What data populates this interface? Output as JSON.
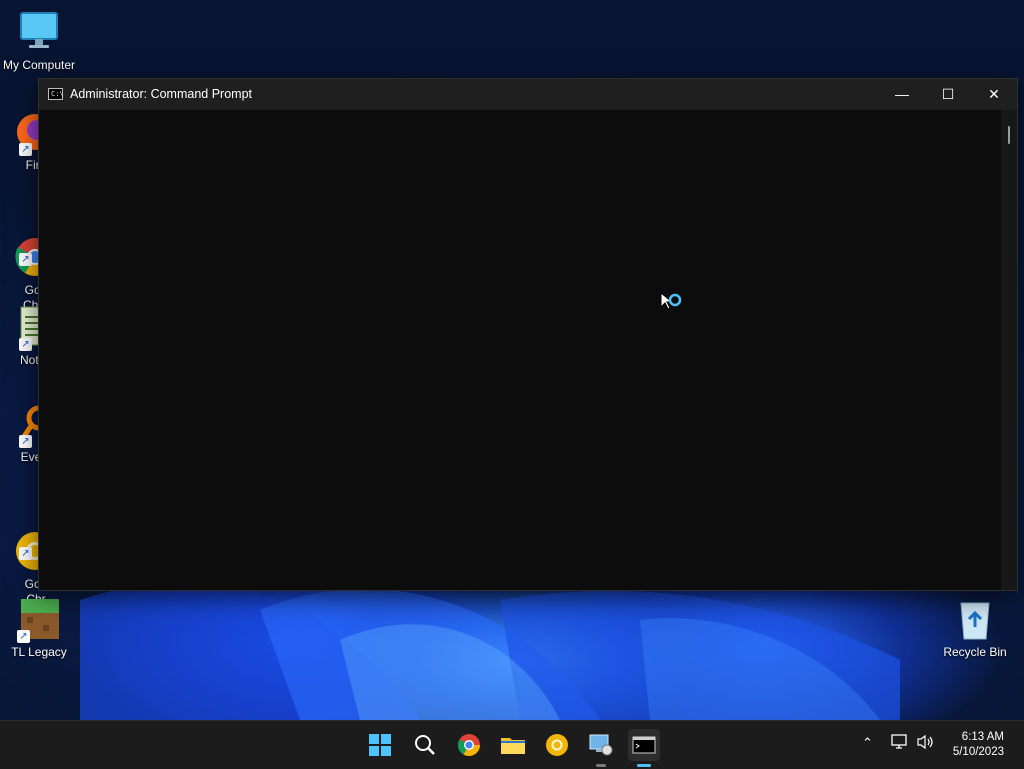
{
  "desktop": {
    "icons": [
      {
        "label": "My Computer"
      },
      {
        "label": "Fire"
      },
      {
        "label": "Goo\nChro"
      },
      {
        "label": "Notep"
      },
      {
        "label": "Every"
      },
      {
        "label": "Goo\nChr"
      },
      {
        "label": "TL Legacy"
      },
      {
        "label": "Recycle Bin"
      }
    ]
  },
  "window": {
    "title": "Administrator:  Command Prompt",
    "icon": "cmd-icon",
    "controls": {
      "minimize": "—",
      "maximize": "☐",
      "close": "✕"
    }
  },
  "taskbar": {
    "apps": [
      "start-icon",
      "search-icon",
      "chrome-icon",
      "file-explorer-icon",
      "chrome-canary-icon",
      "remote-desktop-icon",
      "terminal-icon"
    ],
    "clock": {
      "time": "6:13 AM",
      "date": "5/10/2023"
    }
  },
  "colors": {
    "accent": "#4cc2ff",
    "window_bg": "#0c0c0c",
    "title_bar": "#1f1f1f",
    "taskbar": "#1c1c1c"
  }
}
